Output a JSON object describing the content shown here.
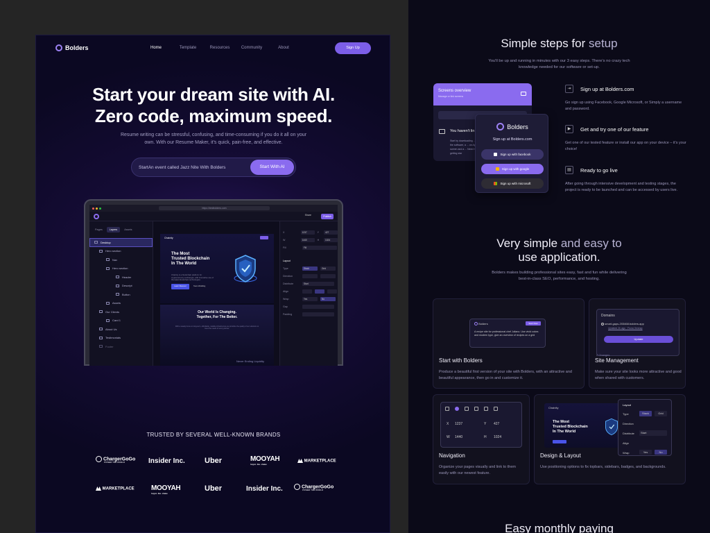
{
  "left": {
    "logo": "Bolders",
    "nav": [
      "Home",
      "Template",
      "Resources",
      "Community",
      "About"
    ],
    "signup": "Sign Up",
    "hero_line1": "Start your dream site with AI.",
    "hero_line2": "Zero code, maximum speed.",
    "hero_sub": "Resume writing can be stressful, confusing, and time-consuming if you do it all on your own. With our Resume Maker, it's quick, pain-free, and effective.",
    "input_value": "StartAn event called Jazz Nite With Bolders",
    "input_button": "Start With AI",
    "editor": {
      "url": "https://testbolders.com",
      "share": "Share",
      "publish": "Publish",
      "tabs": [
        "Pages",
        "Layers",
        "Assets"
      ],
      "layers": [
        "Desktop",
        "Hero section",
        "Nav",
        "Hero section",
        "Header",
        "Descript",
        "Button",
        "Assets",
        "Our Clients",
        "Card 1",
        "About Us",
        "Testimonials",
        "Footer"
      ],
      "canvas_brand": "Chainity",
      "canvas_heading": [
        "The Most",
        "Trusted Blockchain",
        "In The World"
      ],
      "canvas_paragraph": "Chainity is a blockchain platform for cryptocurrency exchanges, with innovative use of the latest blockchain technologies.",
      "canvas_btn1": "Learn Discover",
      "canvas_btn2": "Team Wedding",
      "canvas_section": [
        "Our World Is Changing.",
        "Together, For The Better."
      ],
      "canvas_section_sub": "With a steady focus on long-term, affordable, reliable infrastructure we prioritize the quality of our solutions to meet the needs of every partner.",
      "canvas_footer": "Never Ending Liquidity",
      "props": {
        "x": "1237",
        "y": "427",
        "w": "1440",
        "h": "1024",
        "fill": "Fill",
        "layout": "Layout",
        "type": [
          "Stack",
          "Grid"
        ],
        "direction": "Direction",
        "distribute": "Distribute",
        "distribute_val": "Start",
        "align": "Align",
        "wrap": [
          "Yes",
          "No"
        ],
        "gap": "Gap",
        "padding": "Padding",
        "labels": [
          "Type",
          "Wrap"
        ]
      }
    },
    "trusted": "TRUSTED BY SEVERAL WELL-KNOWN BRANDS",
    "brands_row1": [
      "ChargerGoGo",
      "Insider Inc.",
      "Uber",
      "MOOYAH",
      "MARKETPLACE"
    ],
    "brands_row2": [
      "MARKETPLACE",
      "MOOYAH",
      "Uber",
      "Insider Inc.",
      "ChargerGoGo"
    ],
    "brand_tagline": "POWER THE WORLD",
    "mooyah_tagline": "burgers · fries · shakes"
  },
  "right": {
    "steps_title_a": "Simple steps for ",
    "steps_title_b": "setup",
    "steps_sub": "You'll be up and running in minutes with our 3 easy steps. There's no crazy tech knowledge needed for our software or set-up.",
    "card_header": "Screens overview",
    "card_header_sub": "Manage or link screens",
    "card_haven": "You haven't lin",
    "card_desc": "Start by downloading ... run the software, a ... on App screen and a ... Need help getting star",
    "popup_logo": "Bolders",
    "popup_title": "Sign up at Bolders.com",
    "popup_buttons": [
      "Sign up with facebook",
      "Sign up with google",
      "Sign up with microsoft"
    ],
    "steps": [
      {
        "title": "Sign up at Bolders.com",
        "desc": "Go sign up using Facebook, Google Microsoft, or Simply a username and password.",
        "icon": "login-icon"
      },
      {
        "title": "Get and try one of our feature",
        "desc": "Get one of our tested feature or install our app on your device – it's your choice!",
        "icon": "play-icon"
      },
      {
        "title": "Ready to go live",
        "desc": "After going through intensive development and testing stages, the project is ready to be launched and can be accessed by users live.",
        "icon": "server-icon"
      }
    ],
    "easy_title_a": "Very simple ",
    "easy_title_b": "and easy to",
    "easy_title_c": "use application.",
    "easy_sub": "Bolders makes building professional sites easy, fast and fun while delivering best-in-class SEO, performance, and hosting.",
    "features": [
      {
        "title": "Start with Bolders",
        "desc": "Produce a beautiful first version of your site with Bolders, with an attractive and beautiful appearance, then go in and customize it."
      },
      {
        "title": "Site Management",
        "desc": "Make sure your site looks more attractive and good when shared with customers."
      },
      {
        "title": "Navigation",
        "desc": "Organize your pages visually and link to them easily with our newest feature."
      },
      {
        "title": "Design & Layout",
        "desc": "Use positioning options to fix topbars, sidebars, badges, and backgrounds."
      }
    ],
    "prompt_box": "A recipe site for professional chef Juliano. Use vivid colors and modern type, give an overview of recipes on a grid",
    "prompt_btn": "Start Now",
    "domains": "Domains",
    "domain_url": "smart-gaps-203468.bolders.app",
    "domain_meta": "Updated 2h ago · Fiona Veneap",
    "update": "Update",
    "changes": "2 Changes",
    "nav_x": "1237",
    "nav_y": "427",
    "nav_w": "1440",
    "nav_h": "1024",
    "dl_brand": "Chainity",
    "dl_heading": [
      "The Most",
      "Trusted Blockchain",
      "In The World"
    ],
    "dl_panel": {
      "layout": "Layout",
      "type": "Type",
      "stack": "Stack",
      "grid": "Grid",
      "direction": "Direction",
      "distribute": "Distribute",
      "start": "Start",
      "align": "Align",
      "wrap": "Wrap",
      "yes": "Yes",
      "no": "No"
    },
    "bottom_title": "Easy monthly paying"
  }
}
